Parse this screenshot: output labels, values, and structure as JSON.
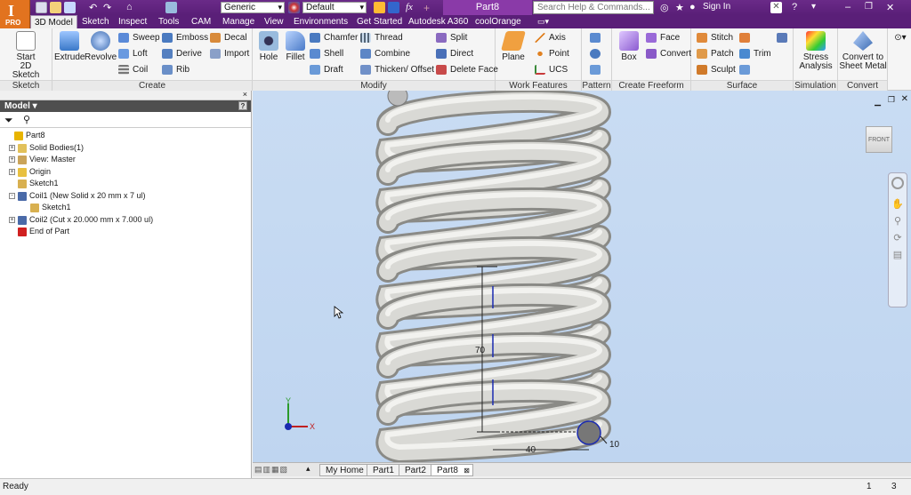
{
  "app": {
    "title": "Part8",
    "pro_label": "PRO",
    "logo": "I"
  },
  "qat": {
    "material": "Generic",
    "appearance": "Default",
    "search_placeholder": "Search Help & Commands...",
    "sign_in": "Sign In"
  },
  "tabs": [
    "3D Model",
    "Sketch",
    "Inspect",
    "Tools",
    "CAM",
    "Manage",
    "View",
    "Environments",
    "Get Started",
    "Autodesk A360",
    "coolOrange"
  ],
  "ribbon": {
    "sketch": {
      "label": "Sketch",
      "start": "Start",
      "start2": "2D Sketch"
    },
    "create": {
      "label": "Create",
      "extrude": "Extrude",
      "revolve": "Revolve",
      "sweep": "Sweep",
      "loft": "Loft",
      "coil": "Coil",
      "emboss": "Emboss",
      "derive": "Derive",
      "rib": "Rib",
      "decal": "Decal",
      "import": "Import"
    },
    "modify": {
      "label": "Modify",
      "hole": "Hole",
      "fillet": "Fillet",
      "chamfer": "Chamfer",
      "shell": "Shell",
      "draft": "Draft",
      "thread": "Thread",
      "combine": "Combine",
      "thicken": "Thicken/ Offset",
      "split": "Split",
      "direct": "Direct",
      "delete_face": "Delete Face"
    },
    "work_features": {
      "label": "Work Features",
      "plane": "Plane",
      "axis": "Axis",
      "point": "Point",
      "ucs": "UCS"
    },
    "pattern": {
      "label": "Pattern"
    },
    "freeform": {
      "label": "Create Freeform",
      "box": "Box",
      "face": "Face",
      "convert": "Convert"
    },
    "surface": {
      "label": "Surface",
      "stitch": "Stitch",
      "patch": "Patch",
      "sculpt": "Sculpt",
      "trim": "Trim"
    },
    "simulation": {
      "label": "Simulation",
      "stress1": "Stress",
      "stress2": "Analysis"
    },
    "convert": {
      "label": "Convert",
      "sheet1": "Convert to",
      "sheet2": "Sheet Metal"
    }
  },
  "browser": {
    "title": "Model",
    "tree": [
      {
        "label": "Part8",
        "indent": 0,
        "expander": "",
        "icon": "#e8b400"
      },
      {
        "label": "Solid Bodies(1)",
        "indent": 1,
        "expander": "+",
        "icon": "#e2c15a"
      },
      {
        "label": "View: Master",
        "indent": 1,
        "expander": "+",
        "icon": "#caa45a"
      },
      {
        "label": "Origin",
        "indent": 1,
        "expander": "+",
        "icon": "#e8c040"
      },
      {
        "label": "Sketch1",
        "indent": 1,
        "expander": "",
        "icon": "#d8b050"
      },
      {
        "label": "Coil1 (New Solid x 20 mm x 7 ul)",
        "indent": 1,
        "expander": "-",
        "icon": "#4a6aa8"
      },
      {
        "label": "Sketch1",
        "indent": 2,
        "expander": "",
        "icon": "#d8b050"
      },
      {
        "label": "Coil2 (Cut x 20.000 mm x 7.000 ul)",
        "indent": 1,
        "expander": "+",
        "icon": "#4a6aa8"
      },
      {
        "label": "End of Part",
        "indent": 1,
        "expander": "",
        "icon": "#d02020"
      }
    ]
  },
  "viewport": {
    "viewcube": "FRONT",
    "dim_height": "70",
    "dim_width": "40",
    "dim_radius": "10",
    "axis_x": "X",
    "axis_y": "Y"
  },
  "doc_tabs": [
    "My Home",
    "Part1",
    "Part2",
    "Part8"
  ],
  "status": {
    "text": "Ready",
    "count1": "1",
    "count2": "3"
  }
}
